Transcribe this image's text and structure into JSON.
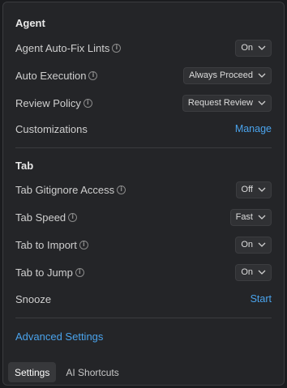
{
  "agent": {
    "title": "Agent",
    "rows": [
      {
        "label": "Agent Auto-Fix Lints",
        "value": "On"
      },
      {
        "label": "Auto Execution",
        "value": "Always Proceed"
      },
      {
        "label": "Review Policy",
        "value": "Request Review"
      },
      {
        "label": "Customizations",
        "link": "Manage"
      }
    ]
  },
  "tab": {
    "title": "Tab",
    "rows": [
      {
        "label": "Tab Gitignore Access",
        "value": "Off"
      },
      {
        "label": "Tab Speed",
        "value": "Fast"
      },
      {
        "label": "Tab to Import",
        "value": "On"
      },
      {
        "label": "Tab to Jump",
        "value": "On"
      },
      {
        "label": "Snooze",
        "link": "Start"
      }
    ]
  },
  "advanced_link": "Advanced Settings",
  "tabs": [
    {
      "label": "Settings",
      "active": true
    },
    {
      "label": "AI Shortcuts",
      "active": false
    }
  ],
  "icons": {
    "info": "info-icon",
    "chevron": "chevron-down-icon"
  },
  "colors": {
    "link": "#4aa3ec",
    "background": "#242528"
  }
}
